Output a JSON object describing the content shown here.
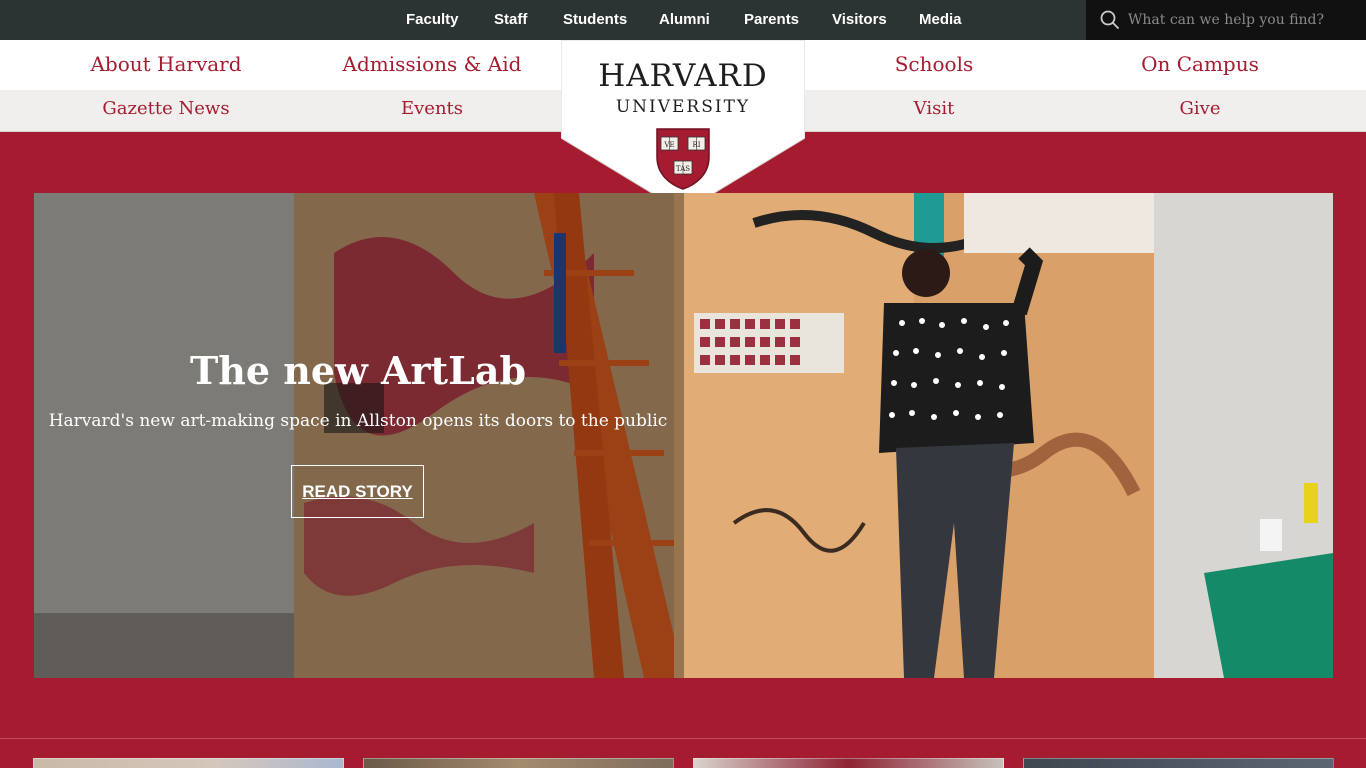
{
  "top_nav": [
    "Faculty",
    "Staff",
    "Students",
    "Alumni",
    "Parents",
    "Visitors",
    "Media"
  ],
  "search": {
    "placeholder": "What can we help you find?"
  },
  "main_nav": [
    "About Harvard",
    "Admissions & Aid",
    "Schools",
    "On Campus"
  ],
  "secondary_nav": [
    "Gazette News",
    "Events",
    "Visit",
    "Give"
  ],
  "logo": {
    "line1": "HARVARD",
    "line2": "UNIVERSITY",
    "motto": [
      "VE",
      "RI",
      "TAS"
    ]
  },
  "hero": {
    "title": "The new ArtLab",
    "subtitle": "Harvard's new art-making space in Allston opens its doors to the public",
    "button": "READ STORY"
  },
  "colors": {
    "crimson": "#a51c30",
    "topbar": "#2c3333",
    "search_bg": "#111111",
    "nav_secondary_bg": "#f0efed"
  }
}
